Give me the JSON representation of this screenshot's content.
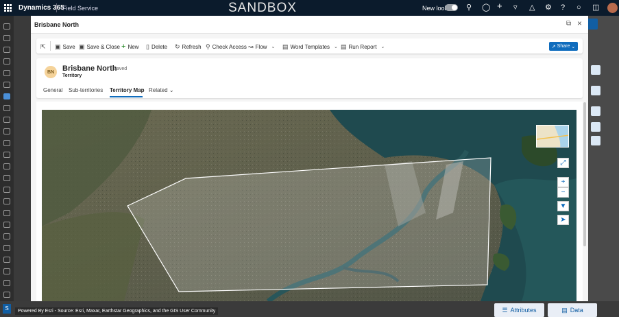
{
  "topbar": {
    "app_name": "Dynamics 365",
    "module": "Field Service",
    "environment": "SANDBOX",
    "new_look_label": "New look",
    "icons": [
      "search-icon",
      "lightbulb-icon",
      "plus-icon",
      "filter-icon",
      "bell-icon",
      "gear-icon",
      "help-icon",
      "chat-icon",
      "share-icon",
      "avatar"
    ]
  },
  "dialog": {
    "title": "Brisbane North",
    "icons": [
      "open-in-new-window-icon",
      "close-icon"
    ]
  },
  "commands": {
    "save": "Save",
    "save_close": "Save & Close",
    "new": "New",
    "delete": "Delete",
    "refresh": "Refresh",
    "check_access": "Check Access",
    "flow": "Flow",
    "word_templates": "Word Templates",
    "run_report": "Run Report",
    "share": "Share"
  },
  "record": {
    "initials": "BN",
    "name": "Brisbane North",
    "status": "- Saved",
    "entity": "Territory"
  },
  "tabs": [
    {
      "label": "General"
    },
    {
      "label": "Sub-territories"
    },
    {
      "label": "Territory Map",
      "active": true
    },
    {
      "label": "Related"
    }
  ],
  "map": {
    "attribution": "Powered By Esri - Source: Esri, Maxar, Earthstar Geographics, and the GIS User Community",
    "controls": [
      "fullscreen-icon",
      "zoom-in-icon",
      "zoom-out-icon",
      "download-icon",
      "locate-icon"
    ]
  },
  "bottom": {
    "help_label": "S",
    "attributes_label": "Attributes",
    "data_label": "Data"
  },
  "colors": {
    "accent": "#0f6cbd",
    "topbar": "#0b1b2c",
    "avatar_bg": "#f5d39a"
  }
}
